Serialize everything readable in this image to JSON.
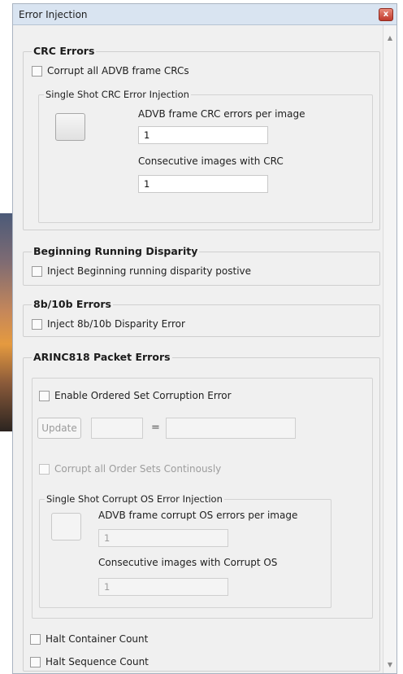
{
  "window": {
    "title": "Error Injection",
    "close_glyph": "x"
  },
  "crc": {
    "title": "CRC Errors",
    "corrupt_all_label": "Corrupt all ADVB frame CRCs",
    "single_shot": {
      "title": "Single Shot CRC Error Injection",
      "per_image_label": "ADVB frame CRC errors per image",
      "per_image_value": "1",
      "consecutive_label": "Consecutive images with CRC",
      "consecutive_value": "1"
    }
  },
  "running_disparity": {
    "title": "Beginning Running Disparity",
    "inject_label": "Inject Beginning running disparity postive"
  },
  "errors_8b10b": {
    "title": "8b/10b Errors",
    "inject_label": "Inject 8b/10b Disparity Error"
  },
  "arinc": {
    "title": "ARINC818 Packet Errors",
    "enable_ordered_set_label": "Enable Ordered Set Corruption Error",
    "update_label": "Update",
    "equals": "=",
    "corrupt_all_order_sets_label": "Corrupt all Order Sets Continously",
    "single_shot": {
      "title": "Single Shot Corrupt OS Error Injection",
      "per_image_label": "ADVB frame corrupt OS errors per image",
      "per_image_value": "1",
      "consecutive_label": "Consecutive images with Corrupt OS",
      "consecutive_value": "1"
    },
    "halt_container_label": "Halt Container Count",
    "halt_sequence_label": "Halt Sequence Count"
  },
  "scrollbar": {
    "up_glyph": "▲",
    "down_glyph": "▼"
  }
}
